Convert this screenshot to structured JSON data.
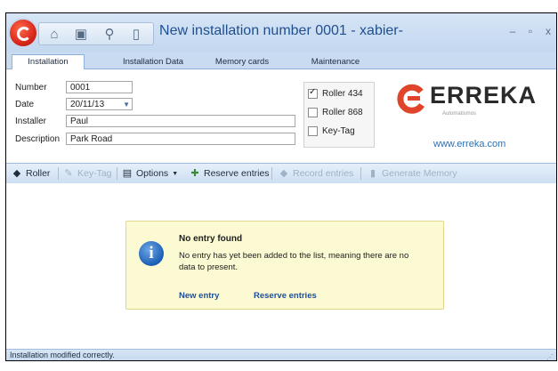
{
  "window": {
    "title": "New installation number 0001 - xabier-",
    "minimize_glyph": "–",
    "maximize_glyph": "▫",
    "close_glyph": "x"
  },
  "qat": {
    "icons": [
      "home-icon",
      "save-icon",
      "search-icon",
      "device-icon"
    ]
  },
  "tabs": [
    {
      "label": "Installation",
      "active": true
    },
    {
      "label": "Installation Data",
      "active": false
    },
    {
      "label": "Memory cards",
      "active": false
    },
    {
      "label": "Maintenance",
      "active": false
    }
  ],
  "form": {
    "number_label": "Number",
    "number_value": "0001",
    "date_label": "Date",
    "date_value": "20/11/13",
    "installer_label": "Installer",
    "installer_value": "Paul",
    "description_label": "Description",
    "description_value": "Park Road"
  },
  "checks": [
    {
      "label": "Roller 434",
      "checked": true
    },
    {
      "label": "Roller 868",
      "checked": false
    },
    {
      "label": "Key-Tag",
      "checked": false
    }
  ],
  "brand": {
    "name": "ERREKA",
    "tagline": "Automatismos",
    "url": "www.erreka.com",
    "color": "#e0442b"
  },
  "toolbar": {
    "roller": "Roller",
    "keytag": "Key-Tag",
    "options": "Options",
    "reserve": "Reserve entries",
    "record": "Record entries",
    "generate": "Generate Memory"
  },
  "notice": {
    "title": "No entry found",
    "text": "No entry has yet been added to the list, meaning there are no data to present.",
    "link_new": "New entry",
    "link_reserve": "Reserve entries"
  },
  "status": {
    "text": "Installation modified correctly."
  }
}
